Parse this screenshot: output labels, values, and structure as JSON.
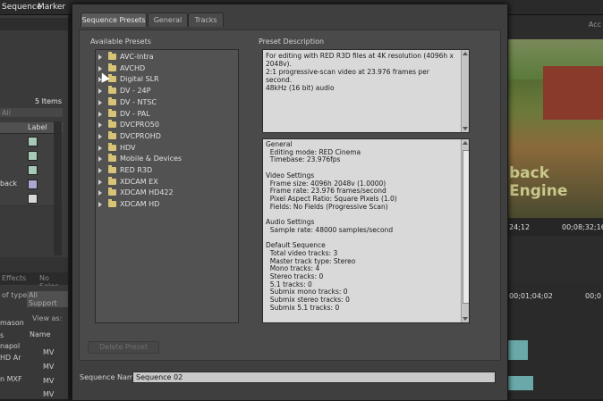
{
  "background": {
    "menu": [
      "Sequence",
      "Marker"
    ],
    "project_items": "5 Items",
    "label_column": "Label",
    "label_colors": [
      "#a8c8b8",
      "#a8c8b8",
      "#a8c8b8",
      "#a8a8d0",
      "#d8d8d8"
    ],
    "left_fragments": [
      "All",
      "back"
    ],
    "lower_left_fragments": [
      "Effects",
      "No Selec",
      "of type:",
      "All Support",
      "View as:",
      "Name",
      "mason",
      "s",
      "napol",
      "HD Ar",
      "n MXF"
    ],
    "file_items": [
      "MV",
      "MV",
      "MV",
      "MV"
    ],
    "video_overlay_text": "back Engine",
    "timecodes": [
      "24;12",
      "00;08;32;16",
      "00;01;04;02",
      "00;0"
    ],
    "top_right_label": "Acc"
  },
  "dialog": {
    "tabs": [
      {
        "label": "Sequence Presets",
        "active": true
      },
      {
        "label": "General",
        "active": false
      },
      {
        "label": "Tracks",
        "active": false
      }
    ],
    "available_presets_label": "Available Presets",
    "preset_description_label": "Preset Description",
    "presets": [
      "AVC-Intra",
      "AVCHD",
      "Digital SLR",
      "DV - 24P",
      "DV - NTSC",
      "DV - PAL",
      "DVCPRO50",
      "DVCPROHD",
      "HDV",
      "Mobile & Devices",
      "RED R3D",
      "XDCAM EX",
      "XDCAM HD422",
      "XDCAM HD"
    ],
    "description": "For editing with RED R3D files at 4K resolution (4096h x 2048v).\n2:1 progressive-scan video at 23.976 frames per second.\n48kHz (16 bit) audio",
    "details": "General\n  Editing mode: RED Cinema\n  Timebase: 23.976fps\n\nVideo Settings\n  Frame size: 4096h 2048v (1.0000)\n  Frame rate: 23.976 frames/second\n  Pixel Aspect Ratio: Square Pixels (1.0)\n  Fields: No Fields (Progressive Scan)\n\nAudio Settings\n  Sample rate: 48000 samples/second\n\nDefault Sequence\n  Total video tracks: 3\n  Master track type: Stereo\n  Mono tracks: 4\n  Stereo tracks: 0\n  5.1 tracks: 0\n  Submix mono tracks: 0\n  Submix stereo tracks: 0\n  Submix 5.1 tracks: 0",
    "delete_preset_label": "Delete Preset",
    "sequence_name_label": "Sequence Name:",
    "sequence_name_value": "Sequence 02"
  }
}
